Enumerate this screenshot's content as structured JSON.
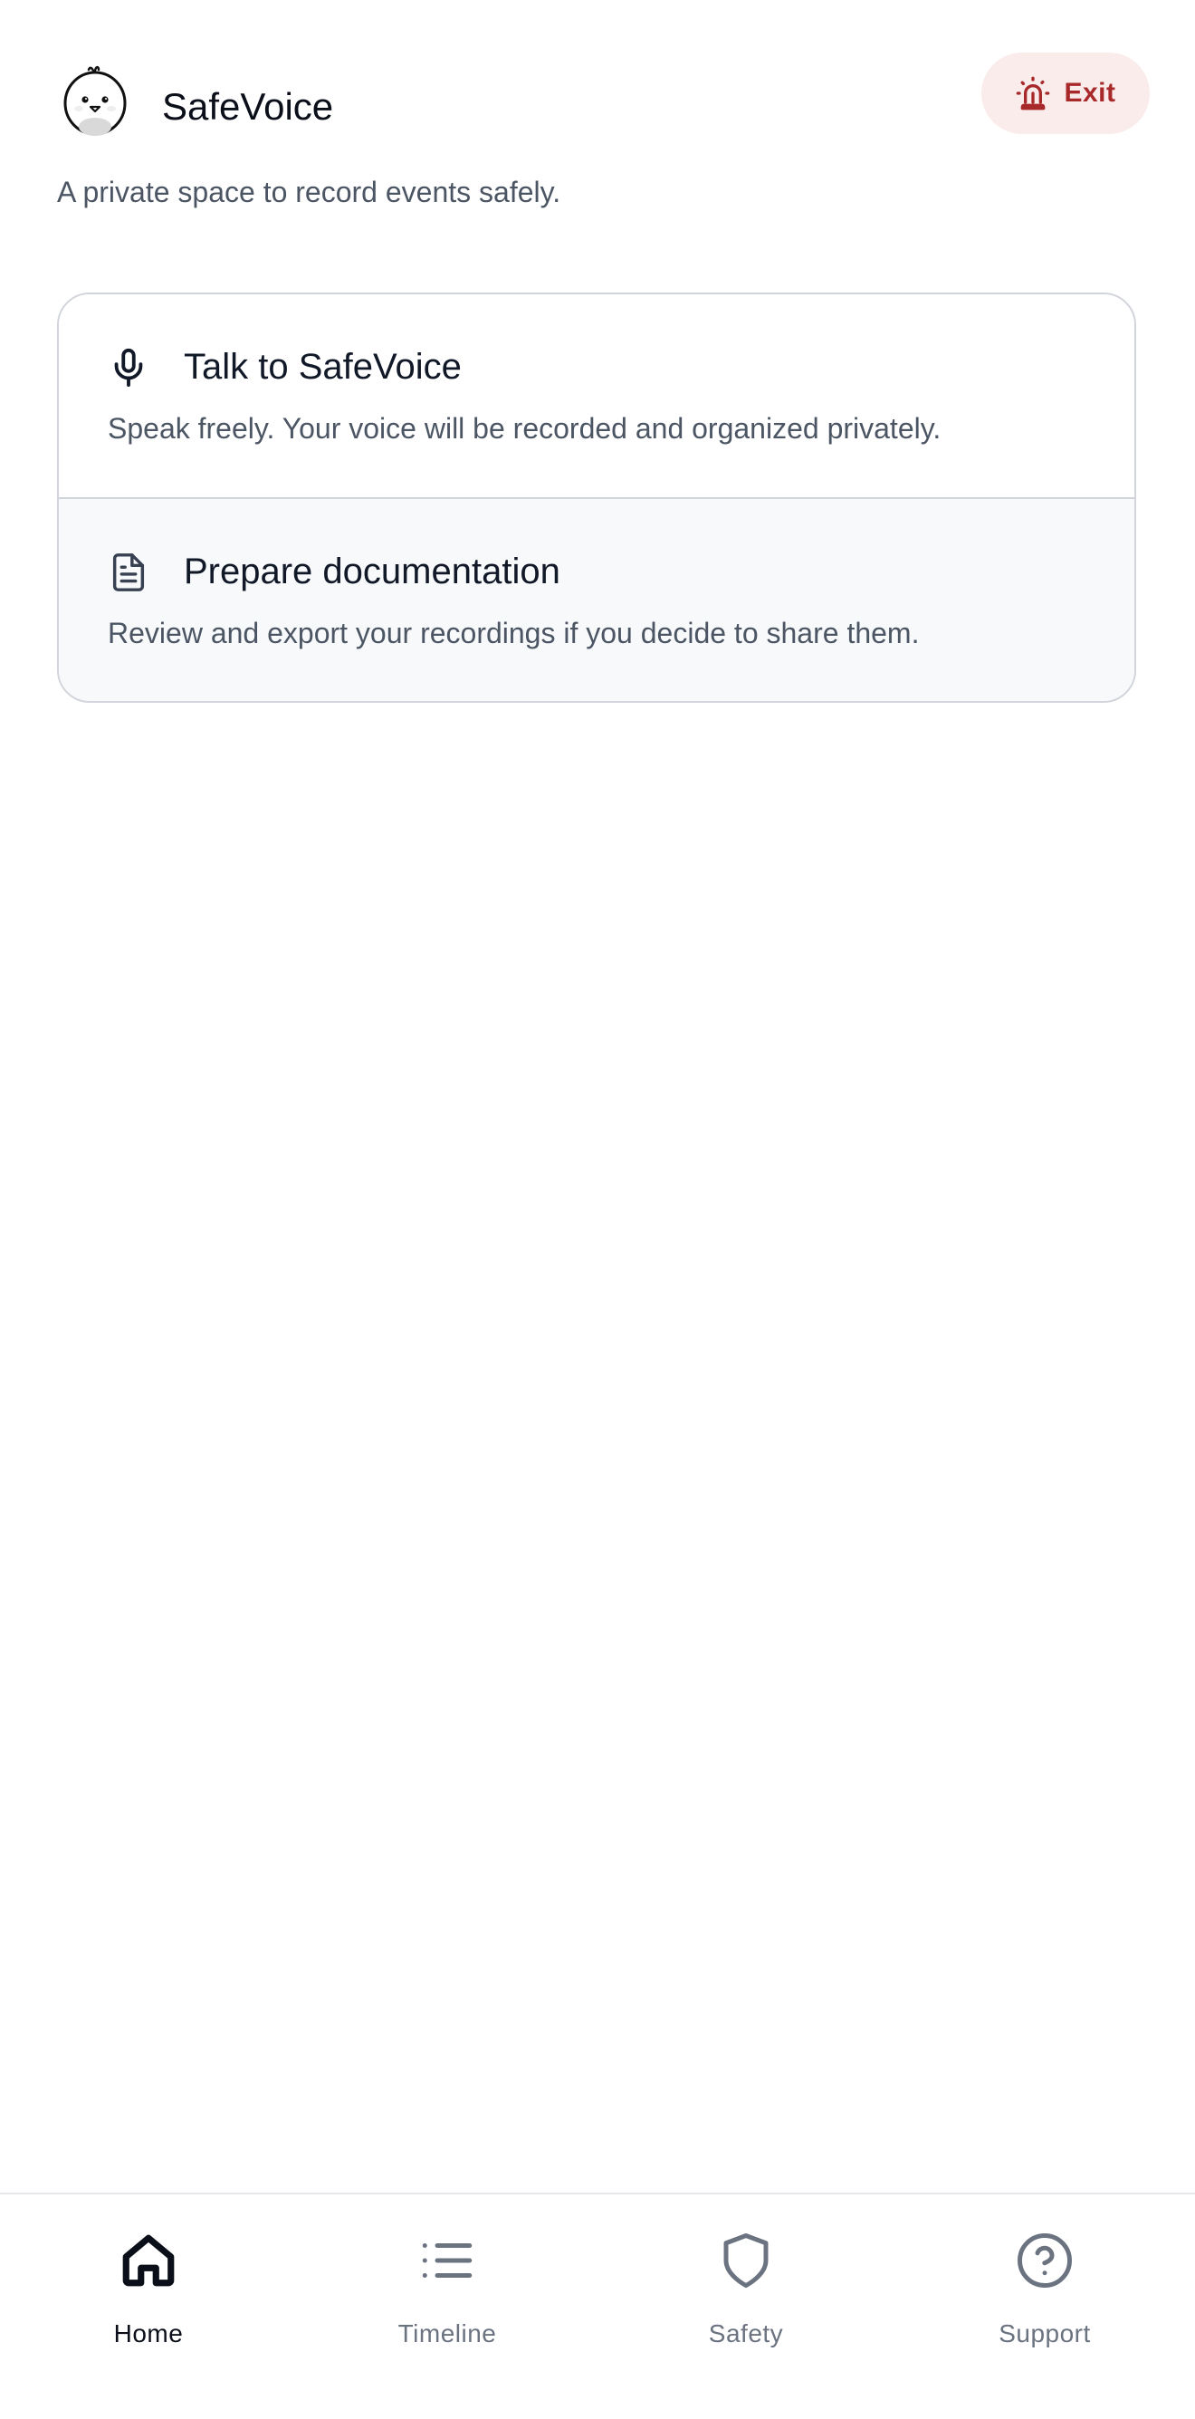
{
  "header": {
    "title": "SafeVoice",
    "subtitle": "A private space to record events safely.",
    "exit_label": "Exit"
  },
  "actions": [
    {
      "title": "Talk to SafeVoice",
      "description": "Speak freely. Your voice will be recorded and organized privately.",
      "icon": "microphone-icon"
    },
    {
      "title": "Prepare documentation",
      "description": "Review and export your recordings if you decide to share them.",
      "icon": "document-icon"
    }
  ],
  "nav": {
    "active": "Home",
    "items": [
      {
        "label": "Home",
        "icon": "home-icon"
      },
      {
        "label": "Timeline",
        "icon": "list-icon"
      },
      {
        "label": "Safety",
        "icon": "shield-icon"
      },
      {
        "label": "Support",
        "icon": "help-circle-icon"
      }
    ]
  },
  "colors": {
    "exit_background": "#fbecec",
    "exit_text": "#a8292a",
    "active_nav": "#0b0f19",
    "inactive_nav": "#6b7280"
  }
}
